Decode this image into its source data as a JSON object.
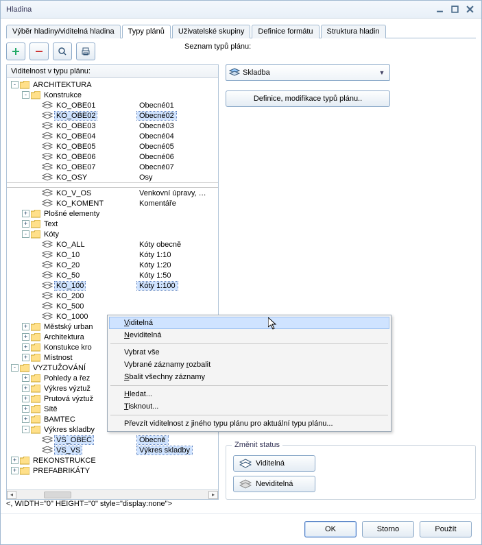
{
  "title": "Hladina",
  "tabs": [
    "Výběr hladiny/viditelná hladina",
    "Typy plánů",
    "Uživatelské skupiny",
    "Definice formátu",
    "Struktura hladin"
  ],
  "activeTab": 1,
  "leftHeader": "Viditelnost v typu plánu:",
  "rightLabel": "Seznam typů plánu:",
  "combo": "Skladba",
  "defBtn": "Definice, modifikace typů plánu..",
  "statusGroup": {
    "legend": "Změnit status",
    "visible": "Viditelná",
    "invisible": "Neviditelná"
  },
  "footer": {
    "ok": "OK",
    "cancel": "Storno",
    "apply": "Použít"
  },
  "contextMenu": {
    "items": [
      {
        "t": "Viditelná",
        "hover": true,
        "u": 0
      },
      {
        "t": "Neviditelná",
        "u": 0
      },
      {
        "sep": true
      },
      {
        "t": "Vybrat vše"
      },
      {
        "t": "Vybrané záznamy rozbalit",
        "u": 16
      },
      {
        "t": "Sbalit všechny záznamy",
        "u": 0
      },
      {
        "sep": true
      },
      {
        "t": "Hledat...",
        "u": 0
      },
      {
        "t": "Tisknout...",
        "u": 0
      },
      {
        "sep": true
      },
      {
        "t": "Převzít viditelnost z jiného typu plánu pro aktuální typu plánu..."
      }
    ]
  },
  "tree": [
    {
      "d": 0,
      "exp": "-",
      "type": "folder",
      "label": "ARCHITEKTURA"
    },
    {
      "d": 1,
      "exp": "-",
      "type": "folder",
      "label": "Konstrukce"
    },
    {
      "d": 2,
      "type": "layer",
      "label": "KO_OBE01",
      "desc": "Obecné01"
    },
    {
      "d": 2,
      "type": "layer",
      "label": "KO_OBE02",
      "desc": "Obecné02",
      "sel": true
    },
    {
      "d": 2,
      "type": "layer",
      "label": "KO_OBE03",
      "desc": "Obecné03"
    },
    {
      "d": 2,
      "type": "layer",
      "label": "KO_OBE04",
      "desc": "Obecné04"
    },
    {
      "d": 2,
      "type": "layer",
      "label": "KO_OBE05",
      "desc": "Obecné05"
    },
    {
      "d": 2,
      "type": "layer",
      "label": "KO_OBE06",
      "desc": "Obecné06"
    },
    {
      "d": 2,
      "type": "layer",
      "label": "KO_OBE07",
      "desc": "Obecné07"
    },
    {
      "d": 2,
      "type": "layer",
      "label": "KO_OSY",
      "desc": "Osy"
    },
    {
      "gap": true
    },
    {
      "d": 2,
      "type": "layer",
      "label": "KO_V_OS",
      "desc": "Venkovní úpravy, …"
    },
    {
      "d": 2,
      "type": "layer",
      "label": "KO_KOMENT",
      "desc": "Komentáře"
    },
    {
      "d": 1,
      "exp": "+",
      "type": "folder",
      "label": "Plošné elementy"
    },
    {
      "d": 1,
      "exp": "+",
      "type": "folder",
      "label": "Text"
    },
    {
      "d": 1,
      "exp": "-",
      "type": "folder",
      "label": "Kóty"
    },
    {
      "d": 2,
      "type": "layer",
      "label": "KO_ALL",
      "desc": "Kóty obecně"
    },
    {
      "d": 2,
      "type": "layer",
      "label": "KO_10",
      "desc": "Kóty 1:10"
    },
    {
      "d": 2,
      "type": "layer",
      "label": "KO_20",
      "desc": "Kóty 1:20"
    },
    {
      "d": 2,
      "type": "layer",
      "label": "KO_50",
      "desc": "Kóty 1:50"
    },
    {
      "d": 2,
      "type": "layer",
      "label": "KO_100",
      "desc": "Kóty 1:100",
      "sel": true
    },
    {
      "d": 2,
      "type": "layer",
      "label": "KO_200"
    },
    {
      "d": 2,
      "type": "layer",
      "label": "KO_500"
    },
    {
      "d": 2,
      "type": "layer",
      "label": "KO_1000"
    },
    {
      "d": 1,
      "exp": "+",
      "type": "folder",
      "label": "Městský urban"
    },
    {
      "d": 1,
      "exp": "+",
      "type": "folder",
      "label": "Architektura"
    },
    {
      "d": 1,
      "exp": "+",
      "type": "folder",
      "label": "Konstukce kro"
    },
    {
      "d": 1,
      "exp": "+",
      "type": "folder",
      "label": "Místnost"
    },
    {
      "d": 0,
      "exp": "-",
      "type": "folder",
      "label": "VYZTUŽOVÁNÍ"
    },
    {
      "d": 1,
      "exp": "+",
      "type": "folder",
      "label": "Pohledy a řez"
    },
    {
      "d": 1,
      "exp": "+",
      "type": "folder",
      "label": "Výkres výztuž"
    },
    {
      "d": 1,
      "exp": "+",
      "type": "folder",
      "label": "Prutová výztuž"
    },
    {
      "d": 1,
      "exp": "+",
      "type": "folder",
      "label": "Sítě"
    },
    {
      "d": 1,
      "exp": "+",
      "type": "folder",
      "label": "BAMTEC"
    },
    {
      "d": 1,
      "exp": "-",
      "type": "folder",
      "label": "Výkres skladby"
    },
    {
      "d": 2,
      "type": "layer",
      "label": "VS_OBEC",
      "desc": "Obecně",
      "sel": true
    },
    {
      "d": 2,
      "type": "layer",
      "label": "VS_VS",
      "desc": "Výkres skladby",
      "sel": true
    },
    {
      "d": 0,
      "exp": "+",
      "type": "folder",
      "label": "REKONSTRUKCE"
    },
    {
      "d": 0,
      "exp": "+",
      "type": "folder",
      "label": "PREFABRIKÁTY"
    }
  ]
}
